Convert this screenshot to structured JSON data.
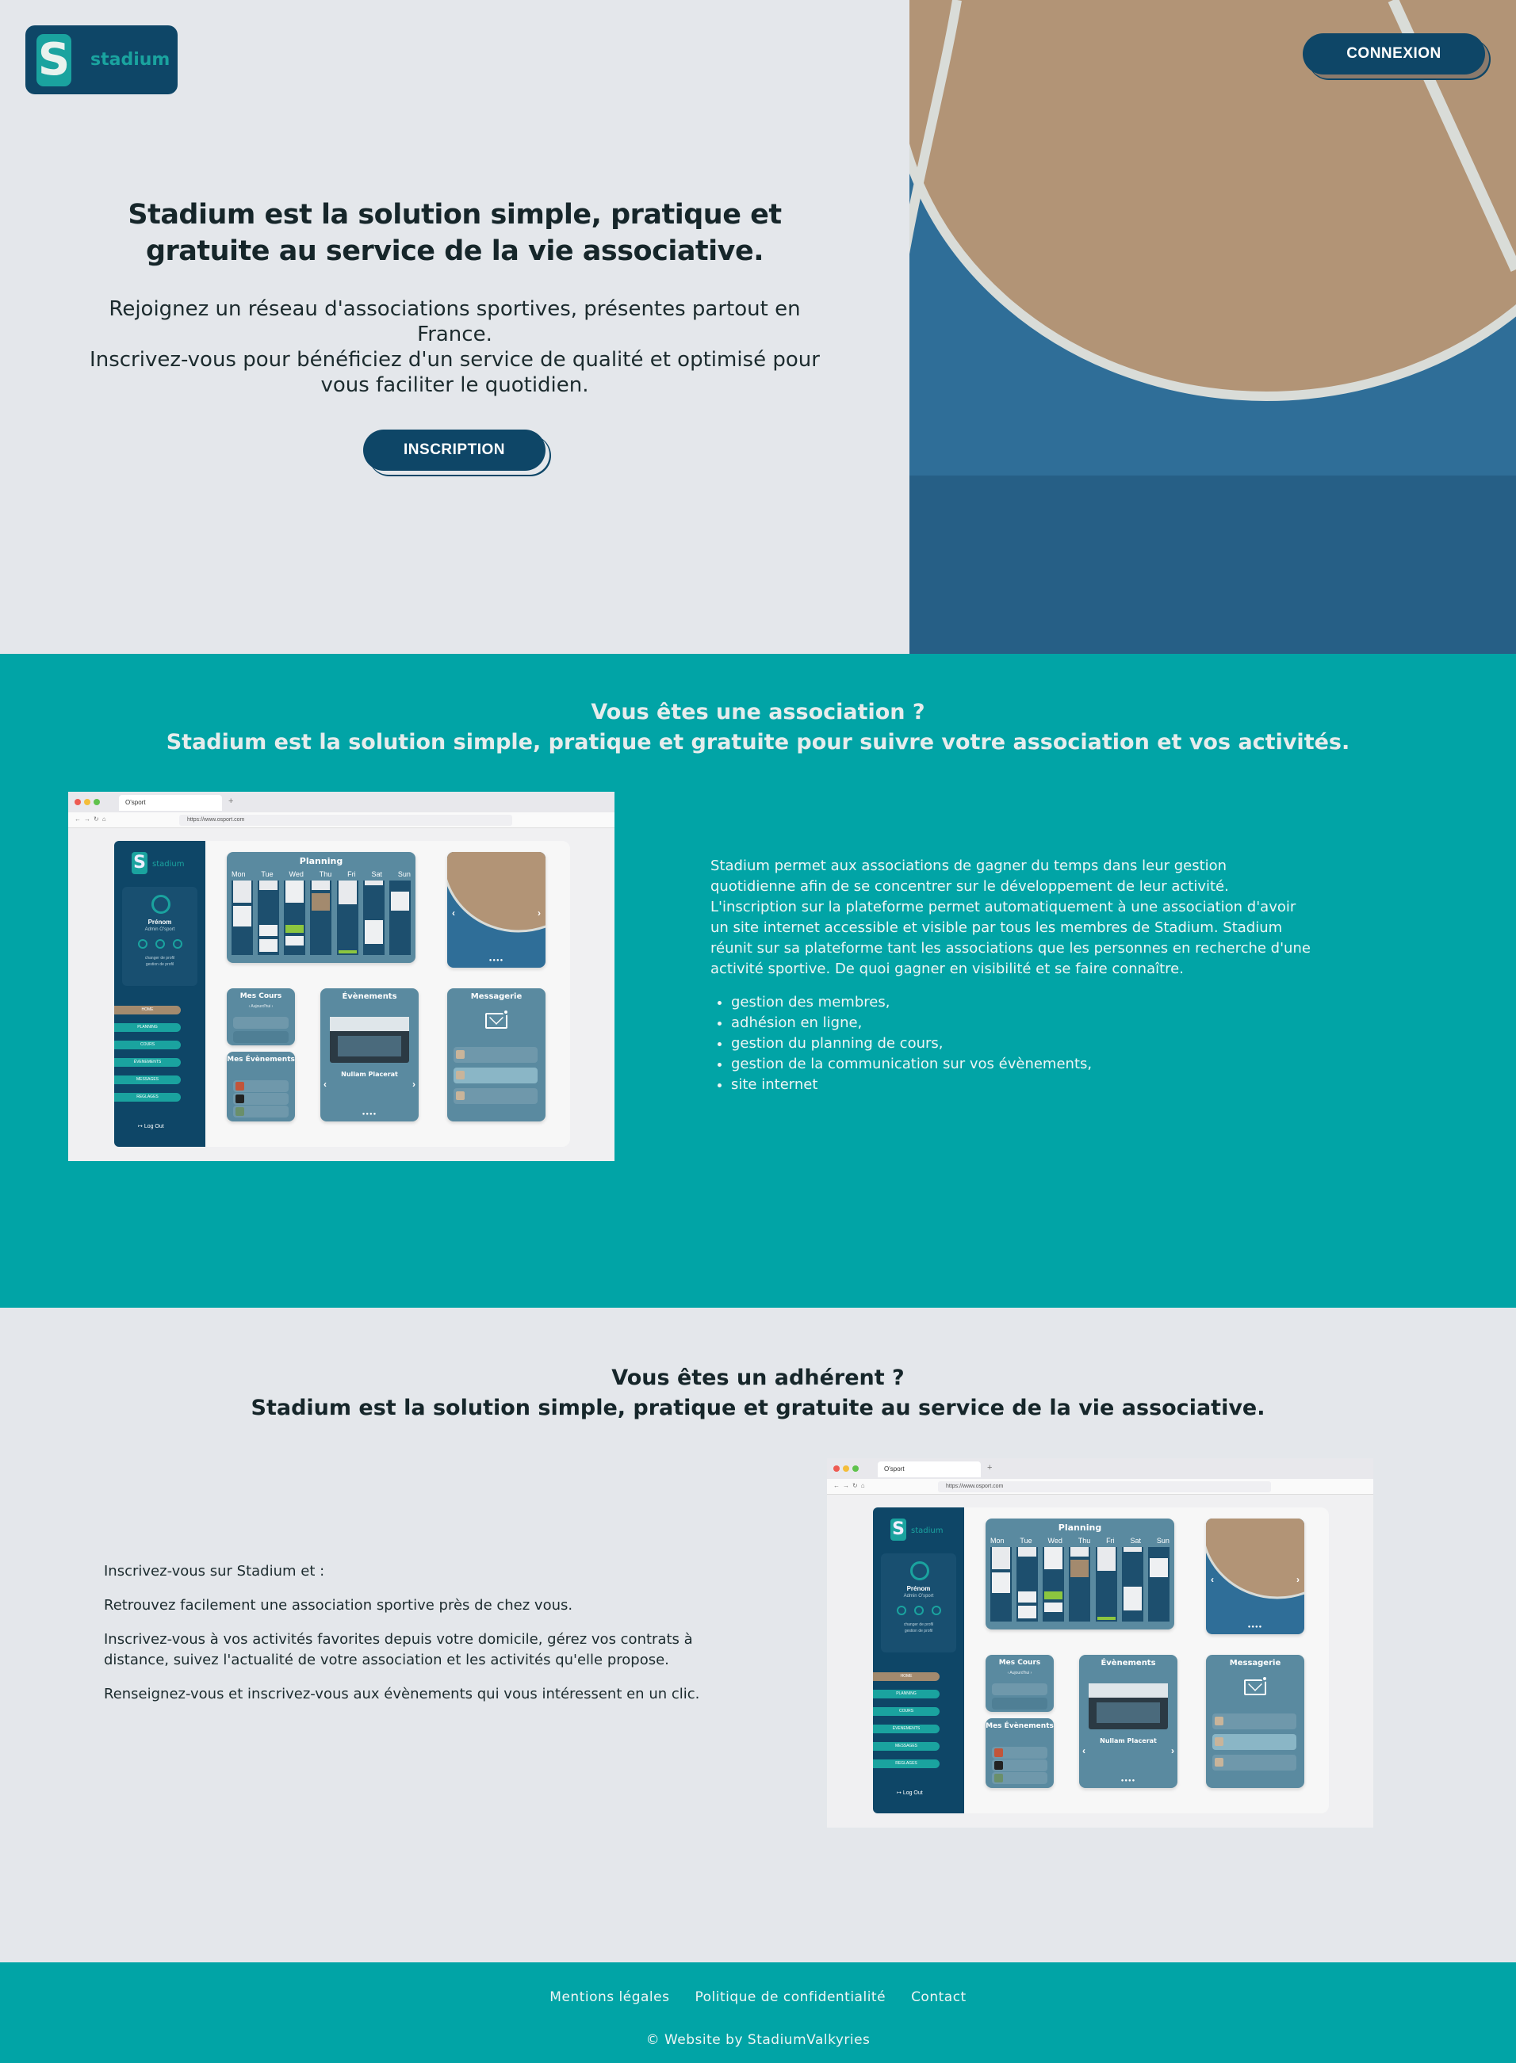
{
  "header": {
    "logo_letter": "S",
    "logo_text": "stadium",
    "login_button": "CONNEXION"
  },
  "hero": {
    "title_line1": "Stadium est la solution simple, pratique et",
    "title_line2": "gratuite au service de la vie associative.",
    "sub_line1": "Rejoignez un réseau d'associations sportives, présentes partout en",
    "sub_line2": "France.",
    "sub_line3": "Inscrivez-vous pour bénéficiez d'un service de qualité et optimisé pour",
    "sub_line4": "vous faciliter le quotidien.",
    "signup_button": "INSCRIPTION"
  },
  "association": {
    "title_line1": "Vous êtes une association ?",
    "title_line2": "Stadium est la solution simple, pratique et gratuite pour suivre votre association et vos activités.",
    "paragraph": "Stadium permet aux associations de gagner du temps dans leur gestion quotidienne afin de se concentrer sur le développement de leur activité. L'inscription sur la plateforme permet automatiquement à une association d'avoir un site internet accessible et visible par tous les membres de Stadium. Stadium réunit sur sa plateforme tant les associations que les personnes en recherche d'une activité sportive. De quoi gagner en visibilité et se faire connaître.",
    "features": [
      "gestion des membres,",
      "adhésion en ligne,",
      "gestion du planning de cours,",
      "gestion de la communication sur vos évènements,",
      "site internet"
    ]
  },
  "member": {
    "title_line1": "Vous êtes un adhérent ?",
    "title_line2": "Stadium est la solution simple, pratique et gratuite au service de la vie associative.",
    "paragraphs": [
      "Inscrivez-vous sur Stadium et :",
      "Retrouvez facilement une association sportive près de chez vous.",
      "Inscrivez-vous à vos activités favorites depuis votre domicile, gérez vos contrats à distance, suivez l'actualité de votre association et les activités qu'elle propose.",
      "Renseignez-vous et inscrivez-vous aux évènements qui vous intéressent en un clic."
    ]
  },
  "mockup": {
    "tab_title": "O'sport",
    "tab_plus": "+",
    "url": "https://www.osport.com",
    "side_logo": "S",
    "side_logo_text": "stadium",
    "profile_name": "Prénom",
    "profile_role": "Admin O'sport",
    "profile_links": "changer de profil\ngestion de profil",
    "menu": [
      "HOME",
      "PLANNING",
      "COURS",
      "ÉVENEMENTS",
      "MESSAGES",
      "REGLAGES"
    ],
    "logout": "Log Out",
    "planning_title": "Planning",
    "days": [
      "Mon",
      "Tue",
      "Wed",
      "Thu",
      "Fri",
      "Sat",
      "Sun"
    ],
    "courses_title": "Mes Cours",
    "courses_date": "Aujourd'hui",
    "my_events_title": "Mes Évènements",
    "events_title": "Évènements",
    "event_name": "Nullam Placerat",
    "messages_title": "Messagerie",
    "colors": {
      "sidebar": "#0e4667",
      "accent": "#1aa39f",
      "card": "#5a8aa0",
      "home_item": "#a38a6e",
      "highlight": "#8cc63f"
    }
  },
  "footer": {
    "links": [
      "Mentions légales",
      "Politique de confidentialité",
      "Contact"
    ],
    "copyright": "© Website by StadiumValkyries"
  },
  "colors": {
    "navy": "#0e4667",
    "teal": "#01a4a6",
    "page_bg": "#e4e7eb",
    "court_blue": "#2a6a95",
    "court_tan": "#b29476"
  }
}
